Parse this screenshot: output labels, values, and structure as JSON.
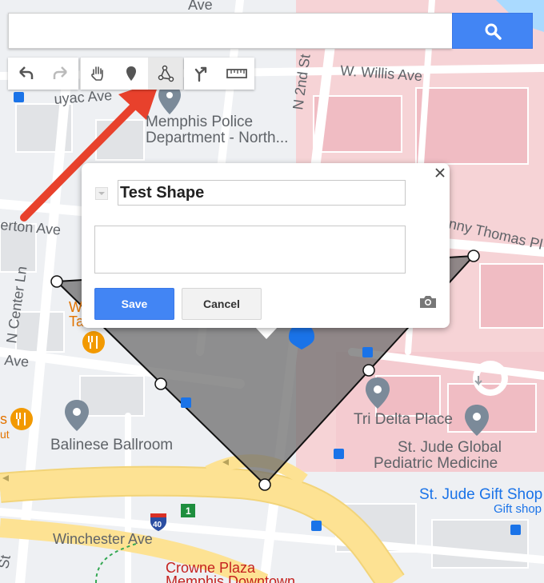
{
  "search": {
    "value": "",
    "placeholder": ""
  },
  "toolbar": {
    "buttons": [
      {
        "name": "undo",
        "icon": "undo-icon"
      },
      {
        "name": "redo",
        "icon": "redo-icon"
      },
      {
        "name": "select",
        "icon": "hand-icon"
      },
      {
        "name": "add-marker",
        "icon": "marker-icon"
      },
      {
        "name": "draw-line",
        "icon": "draw-line-icon",
        "active": true
      },
      {
        "name": "directions",
        "icon": "directions-icon"
      },
      {
        "name": "measure",
        "icon": "ruler-icon"
      }
    ]
  },
  "map_labels": {
    "street_ave_top": "Ave",
    "w_willis": "W. Willis Ave",
    "n_2nd": "N 2nd St",
    "uyac": "uyac Ave",
    "erton": "erton Ave",
    "n_center_ln": "N Center Ln",
    "ave_left": "Ave",
    "danny_thomas": "nny Thomas Pl",
    "police_line1": "Memphis Police",
    "police_line2": "Department -  North...",
    "w_partial": "W",
    "ta_partial": "Ta",
    "s_partial": "s",
    "ut_partial": "ut",
    "balinese": "Balinese Ballroom",
    "tri_delta": "Tri Delta Place",
    "st_jude_line1": "St. Jude Global",
    "st_jude_line2": "Pediatric Medicine",
    "gift_shop": "St. Jude Gift Shop",
    "gift_shop_sub": "Gift shop",
    "winchester": "Winchester Ave",
    "crowne_line1": "Crowne Plaza",
    "crowne_line2": "Memphis Downtown",
    "st_bottom": "St",
    "route_40": "40",
    "route_1": "1"
  },
  "dialog": {
    "title": "Test Shape",
    "description": "",
    "save_label": "Save",
    "cancel_label": "Cancel"
  },
  "colors": {
    "accent": "#4285f4",
    "arrow": "#e8412c",
    "shape_fill": "#7a7a7a",
    "highway": "#fde293",
    "building_pink": "#f4cbd0"
  }
}
